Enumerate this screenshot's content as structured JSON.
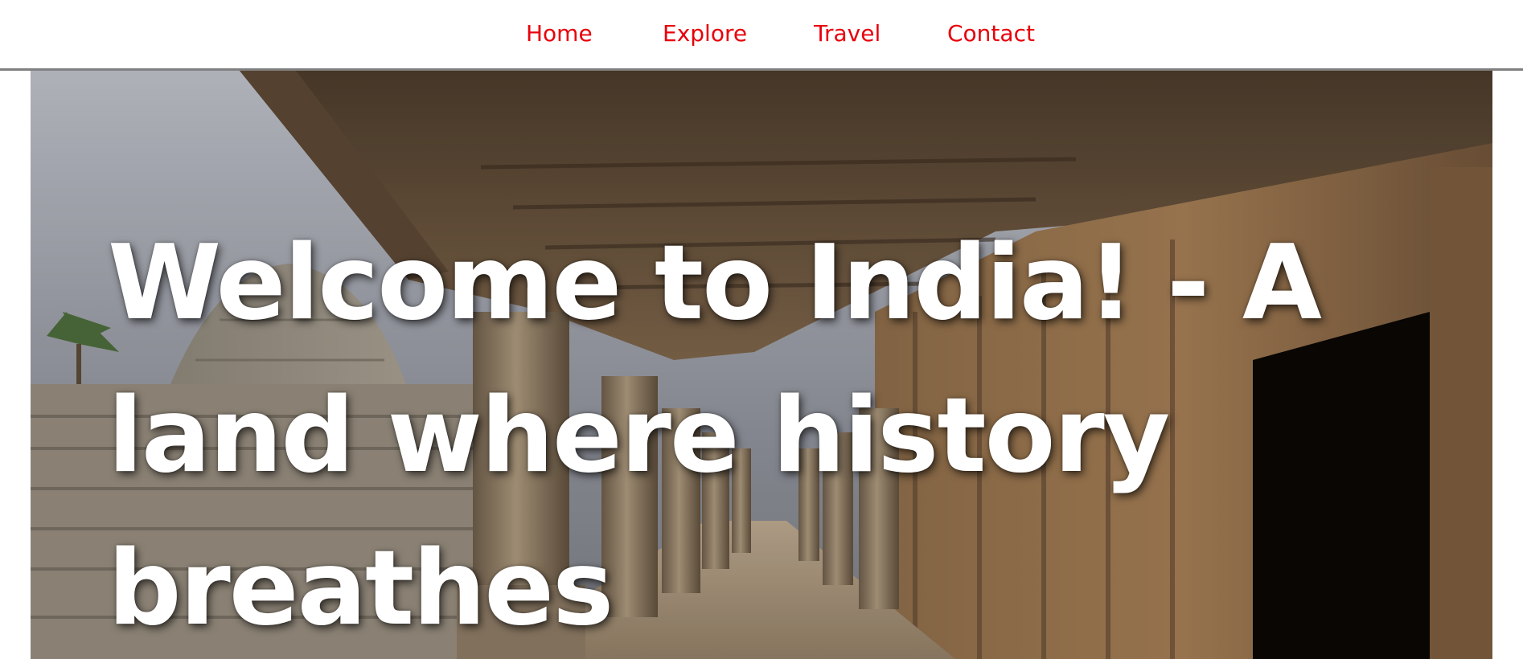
{
  "nav": {
    "items": [
      {
        "label": "Home"
      },
      {
        "label": "Explore"
      },
      {
        "label": "Travel"
      },
      {
        "label": "Contact"
      }
    ],
    "link_color": "#e8000b"
  },
  "hero": {
    "image": "temple-colonnade-image",
    "title": "Welcome to India! - A land where history breathes",
    "title_color": "#ffffff"
  }
}
